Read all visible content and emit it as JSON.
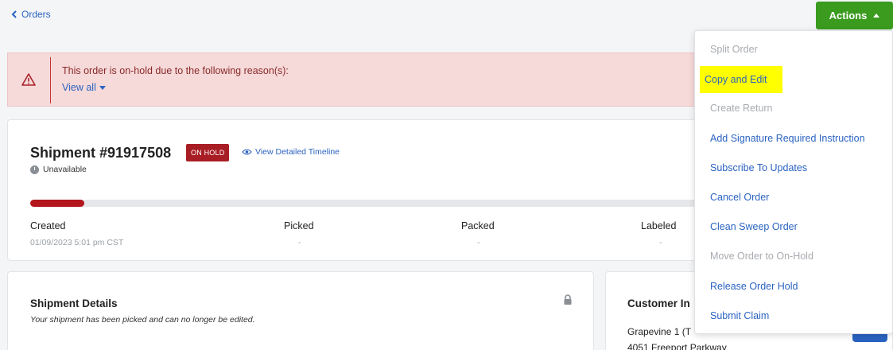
{
  "nav": {
    "back_label": "Orders"
  },
  "actions": {
    "label": "Actions",
    "accent": "#3a9b1f",
    "menu": [
      {
        "label": "Split Order",
        "enabled": false
      },
      {
        "label": "Copy and Edit",
        "enabled": true,
        "highlighted": true
      },
      {
        "label": "Create Return",
        "enabled": false
      },
      {
        "label": "Add Signature Required Instruction",
        "enabled": true
      },
      {
        "label": "Subscribe To Updates",
        "enabled": true
      },
      {
        "label": "Cancel Order",
        "enabled": true
      },
      {
        "label": "Clean Sweep Order",
        "enabled": true
      },
      {
        "label": "Move Order to On-Hold",
        "enabled": false
      },
      {
        "label": "Release Order Hold",
        "enabled": true
      },
      {
        "label": "Submit Claim",
        "enabled": true
      }
    ]
  },
  "alert": {
    "icon": "warning-icon",
    "message": "This order is on-hold due to the following reason(s):",
    "link": "View all"
  },
  "shipment": {
    "title": "Shipment #91917508",
    "badge": "ON HOLD",
    "badge_color": "#a81d24",
    "timeline_link": "View Detailed Timeline",
    "status": "Unavailable",
    "progress_fraction": 0.08,
    "steps": [
      {
        "label": "Created",
        "date": "01/09/2023 5:01 pm CST"
      },
      {
        "label": "Picked",
        "date": "-"
      },
      {
        "label": "Packed",
        "date": "-"
      },
      {
        "label": "Labeled",
        "date": "-"
      }
    ]
  },
  "details": {
    "title": "Shipment Details",
    "note": "Your shipment has been picked and can no longer be edited."
  },
  "customer": {
    "title": "Customer In",
    "line1": "Grapevine 1 (T",
    "line2": "4051 Freeport Parkway"
  }
}
